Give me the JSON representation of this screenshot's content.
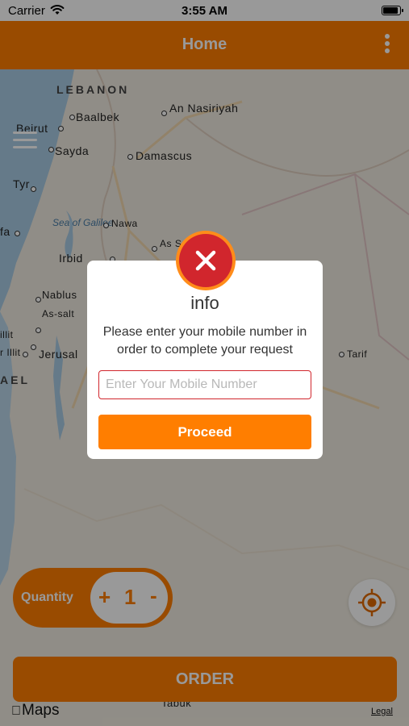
{
  "status_bar": {
    "carrier": "Carrier",
    "time": "3:55 AM"
  },
  "nav": {
    "title": "Home"
  },
  "map": {
    "labels": {
      "lebanon": "LEBANON",
      "beirut": "Beirut",
      "baalbek": "Baalbek",
      "sayda": "Sayda",
      "tyr": "Tyr",
      "damascus": "Damascus",
      "an_nasiriyah": "An Nasiriyah",
      "sea_of_galilee": "Sea of Galilee",
      "nawa": "Nawa",
      "as_s": "As S",
      "fa": "fa",
      "irbid": "Irbid",
      "nablus": "Nablus",
      "as_salt": "As-salt",
      "illit": "illit",
      "r_illit": "r Illit",
      "jerusalem": "Jerusal",
      "ael": "AEL",
      "tarif": "Tarif",
      "tabuk": "Tabuk"
    }
  },
  "quantity": {
    "label": "Quantity",
    "value": "1",
    "plus": "+",
    "minus": "-"
  },
  "order": {
    "label": "ORDER"
  },
  "footer": {
    "maps": "Maps",
    "legal": "Legal"
  },
  "dialog": {
    "title": "info",
    "message": "Please enter your mobile number in order to complete your request",
    "input_placeholder": "Enter Your Mobile Number",
    "input_value": "",
    "proceed_label": "Proceed"
  },
  "colors": {
    "accent": "#ff7e00",
    "error_red": "#d1262d",
    "overlay": "rgba(0,0,0,0.40)"
  }
}
